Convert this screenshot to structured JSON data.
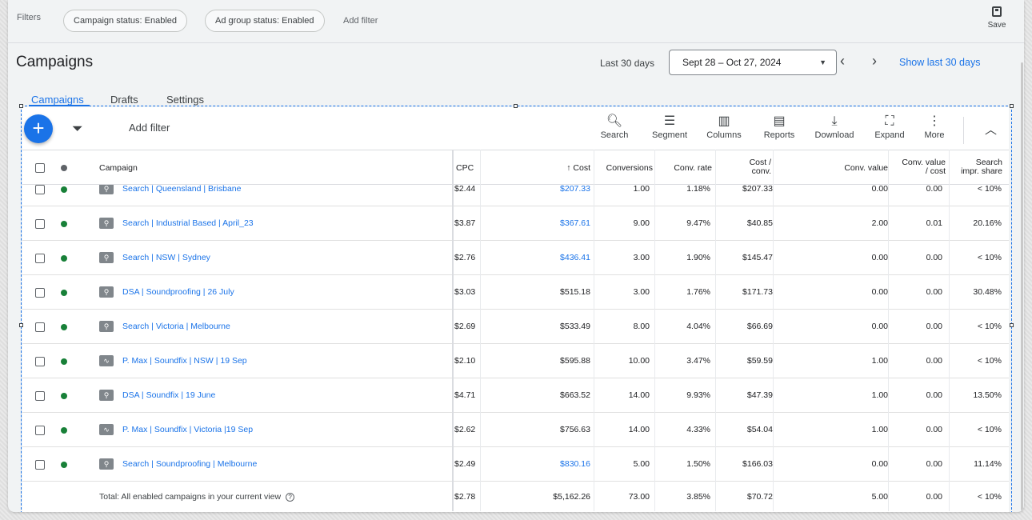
{
  "filters": {
    "label": "Filters",
    "chips": [
      "Campaign status: Enabled",
      "Ad group status: Enabled"
    ],
    "add_filter": "Add filter",
    "save_label": "Save"
  },
  "header": {
    "title": "Campaigns",
    "range_label": "Last 30 days",
    "date_range": "Sept 28 – Oct 27, 2024",
    "show_last": "Show last 30 days"
  },
  "tabs": [
    "Campaigns",
    "Drafts",
    "Settings"
  ],
  "toolbar": {
    "add_filter": "Add filter",
    "tools": [
      {
        "label": "Search",
        "icon": "search-icon",
        "glyph": "🔍︎"
      },
      {
        "label": "Segment",
        "icon": "segment-icon",
        "glyph": "☰"
      },
      {
        "label": "Columns",
        "icon": "columns-icon",
        "glyph": "▥"
      },
      {
        "label": "Reports",
        "icon": "reports-icon",
        "glyph": "▤"
      },
      {
        "label": "Download",
        "icon": "download-icon",
        "glyph": "⤓"
      },
      {
        "label": "Expand",
        "icon": "expand-icon",
        "glyph": "⛶"
      },
      {
        "label": "More",
        "icon": "more-icon",
        "glyph": "⋮"
      }
    ]
  },
  "colors": {
    "accent": "#1a73e8",
    "enabled_dot": "#188038",
    "header_dot": "#5f6368"
  },
  "table": {
    "headers": {
      "campaign": "Campaign",
      "cpc": "CPC",
      "cost": "↑ Cost",
      "conversions": "Conversions",
      "conv_rate": "Conv. rate",
      "cost_conv": "Cost / conv.",
      "conv_value": "Conv. value",
      "conv_value_cost": "Conv. value / cost",
      "search_impr": "Search impr. share"
    },
    "rows": [
      {
        "name": "Search | Queensland | Brisbane",
        "type": "search",
        "cpc": "$2.44",
        "cost": "$207.33",
        "cost_link": true,
        "conversions": "1.00",
        "conv_rate": "1.18%",
        "cost_conv": "$207.33",
        "conv_value": "0.00",
        "conv_value_cost": "0.00",
        "search_impr": "< 10%"
      },
      {
        "name": "Search | Industrial Based | April_23",
        "type": "search",
        "cpc": "$3.87",
        "cost": "$367.61",
        "cost_link": true,
        "conversions": "9.00",
        "conv_rate": "9.47%",
        "cost_conv": "$40.85",
        "conv_value": "2.00",
        "conv_value_cost": "0.01",
        "search_impr": "20.16%"
      },
      {
        "name": "Search | NSW | Sydney",
        "type": "search",
        "cpc": "$2.76",
        "cost": "$436.41",
        "cost_link": true,
        "conversions": "3.00",
        "conv_rate": "1.90%",
        "cost_conv": "$145.47",
        "conv_value": "0.00",
        "conv_value_cost": "0.00",
        "search_impr": "< 10%"
      },
      {
        "name": "DSA | Soundproofing | 26 July",
        "type": "search",
        "cpc": "$3.03",
        "cost": "$515.18",
        "cost_link": false,
        "conversions": "3.00",
        "conv_rate": "1.76%",
        "cost_conv": "$171.73",
        "conv_value": "0.00",
        "conv_value_cost": "0.00",
        "search_impr": "30.48%"
      },
      {
        "name": "Search | Victoria | Melbourne",
        "type": "search",
        "cpc": "$2.69",
        "cost": "$533.49",
        "cost_link": false,
        "conversions": "8.00",
        "conv_rate": "4.04%",
        "cost_conv": "$66.69",
        "conv_value": "0.00",
        "conv_value_cost": "0.00",
        "search_impr": "< 10%"
      },
      {
        "name": "P. Max | Soundfix | NSW | 19 Sep",
        "type": "pmax",
        "cpc": "$2.10",
        "cost": "$595.88",
        "cost_link": false,
        "conversions": "10.00",
        "conv_rate": "3.47%",
        "cost_conv": "$59.59",
        "conv_value": "1.00",
        "conv_value_cost": "0.00",
        "search_impr": "< 10%"
      },
      {
        "name": "DSA | Soundfix | 19 June",
        "type": "search",
        "cpc": "$4.71",
        "cost": "$663.52",
        "cost_link": false,
        "conversions": "14.00",
        "conv_rate": "9.93%",
        "cost_conv": "$47.39",
        "conv_value": "1.00",
        "conv_value_cost": "0.00",
        "search_impr": "13.50%"
      },
      {
        "name": "P. Max | Soundfix | Victoria |19 Sep",
        "type": "pmax",
        "cpc": "$2.62",
        "cost": "$756.63",
        "cost_link": false,
        "conversions": "14.00",
        "conv_rate": "4.33%",
        "cost_conv": "$54.04",
        "conv_value": "1.00",
        "conv_value_cost": "0.00",
        "search_impr": "< 10%"
      },
      {
        "name": "Search | Soundproofing | Melbourne",
        "type": "search",
        "cpc": "$2.49",
        "cost": "$830.16",
        "cost_link": true,
        "conversions": "5.00",
        "conv_rate": "1.50%",
        "cost_conv": "$166.03",
        "conv_value": "0.00",
        "conv_value_cost": "0.00",
        "search_impr": "11.14%"
      }
    ],
    "total": {
      "label": "Total: All enabled campaigns in your current view",
      "cpc": "$2.78",
      "cost": "$5,162.26",
      "conversions": "73.00",
      "conv_rate": "3.85%",
      "cost_conv": "$70.72",
      "conv_value": "5.00",
      "conv_value_cost": "0.00",
      "search_impr": "< 10%"
    }
  }
}
